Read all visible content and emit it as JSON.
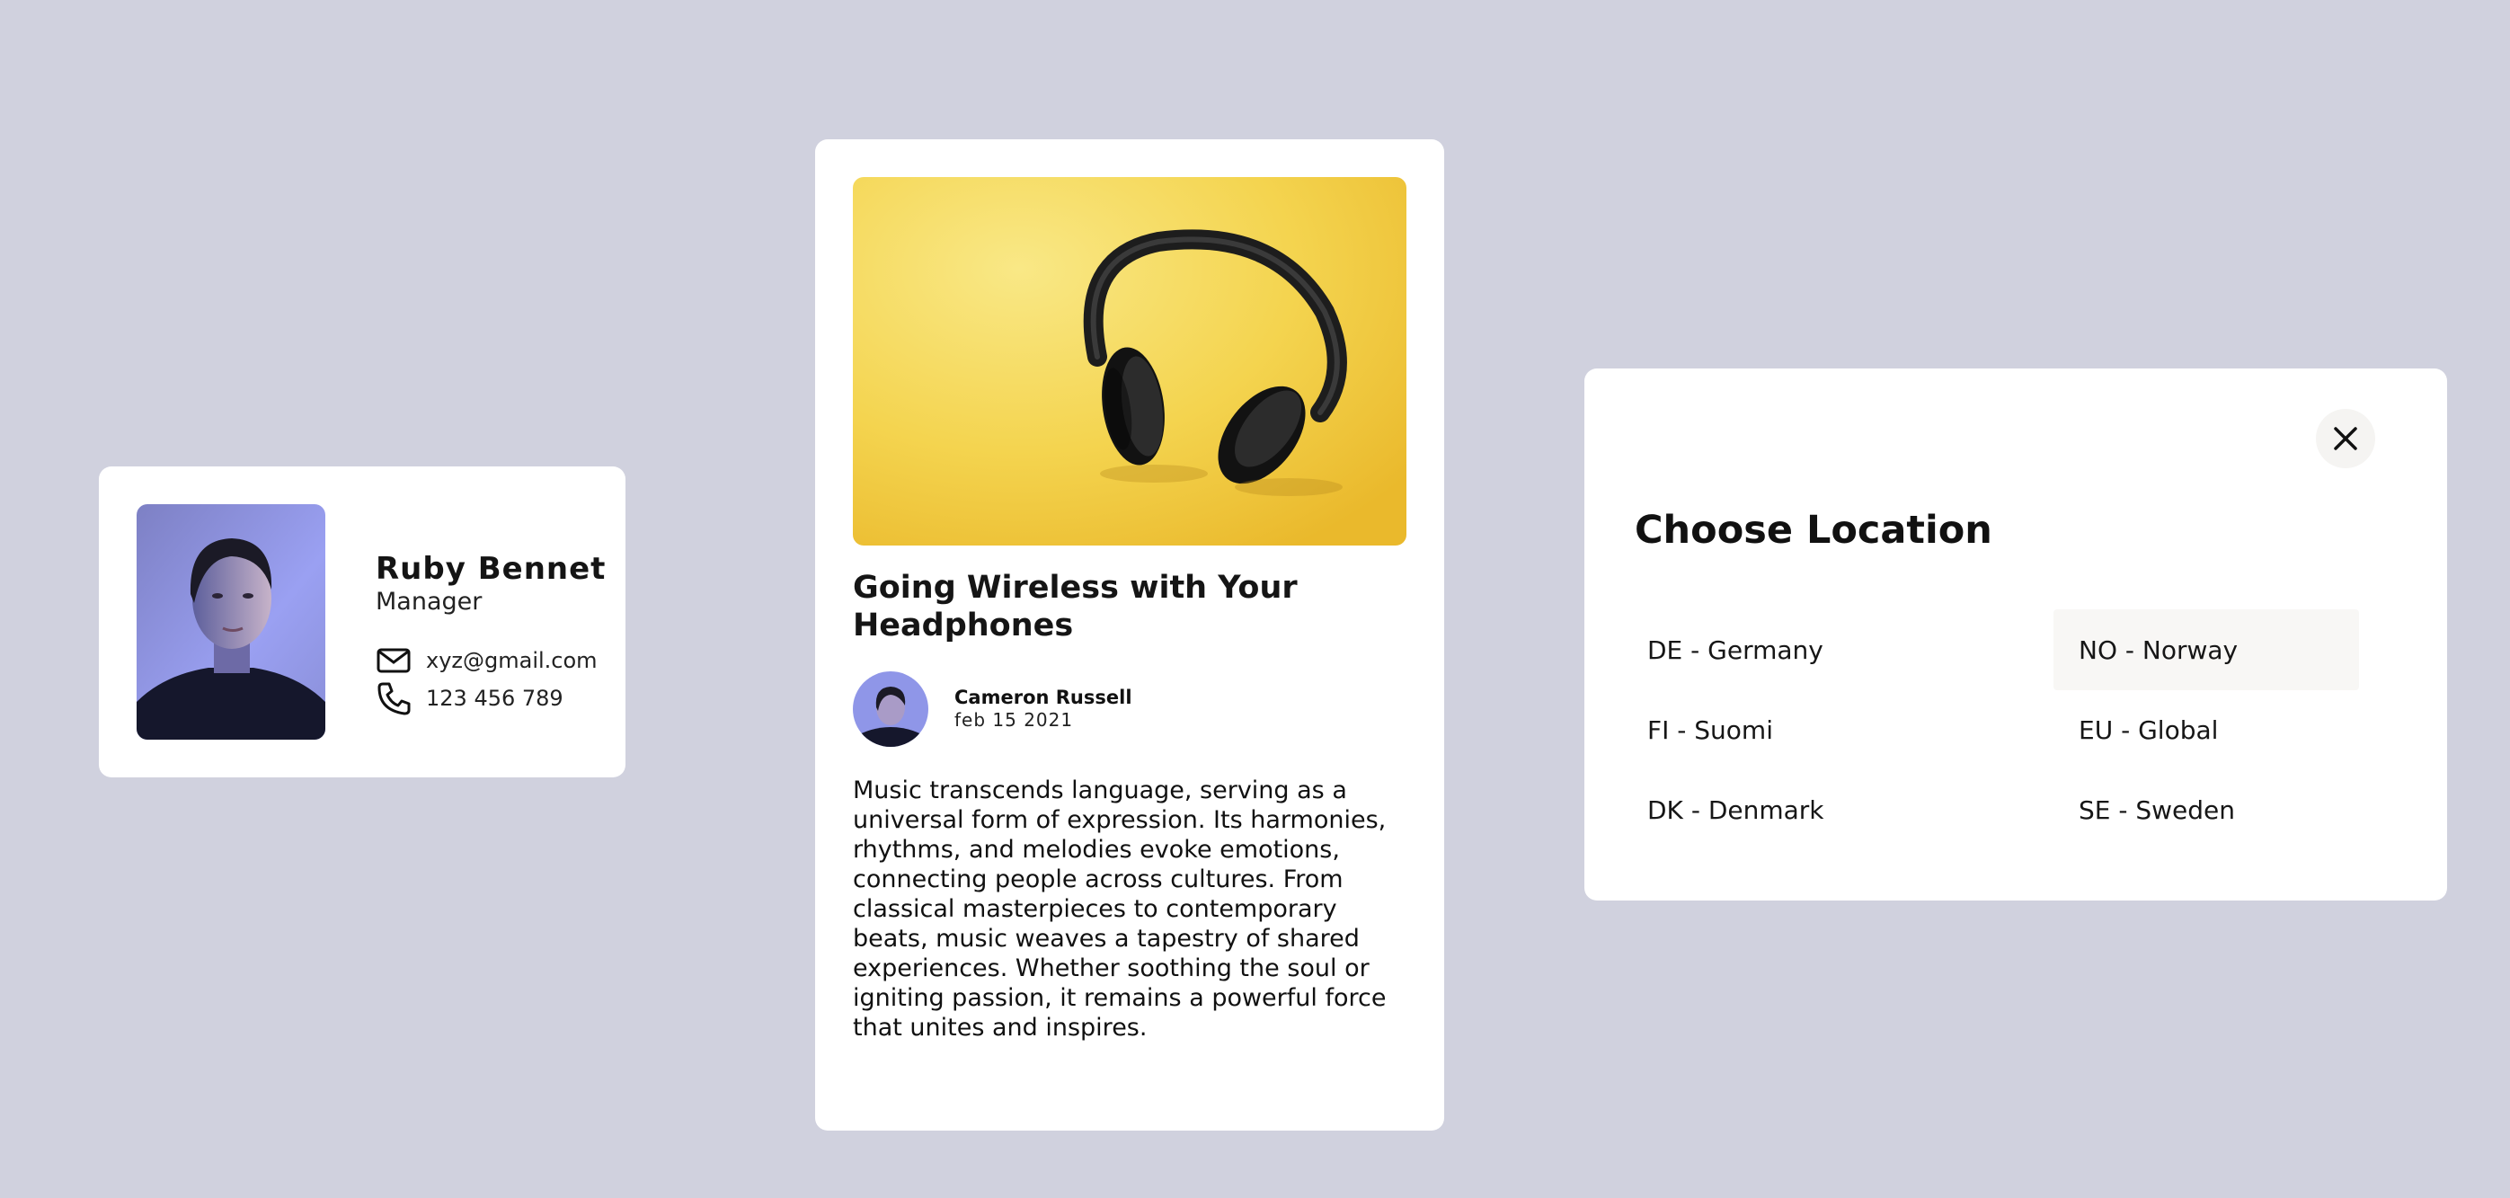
{
  "contact": {
    "name": "Ruby Bennet",
    "role": "Manager",
    "email": "xyz@gmail.com",
    "phone": "123 456 789",
    "icons": {
      "email": "mail-icon",
      "phone": "phone-icon"
    }
  },
  "article": {
    "title": "Going Wireless with Your Headphones",
    "author": "Cameron Russell",
    "date": "feb 15 2021",
    "body": "Music transcends language, serving as a universal form of expression. Its harmonies, rhythms, and melodies evoke emotions, connecting people across cultures. From classical masterpieces to contemporary beats, music weaves a tapestry of shared experiences. Whether soothing the soul or igniting passion, it remains a powerful force that unites and inspires."
  },
  "location_dialog": {
    "heading": "Choose Location",
    "close_icon": "close-icon",
    "options": [
      "DE - Germany",
      "NO - Norway",
      "FI - Suomi",
      "EU - Global",
      "DK - Denmark",
      "SE - Sweden"
    ],
    "highlighted_option": "NO - Norway"
  },
  "colors": {
    "background": "#d0d1de",
    "card": "#ffffff",
    "hero_yellow": "#f6d24a",
    "portrait_blue": "#8f96e8"
  }
}
